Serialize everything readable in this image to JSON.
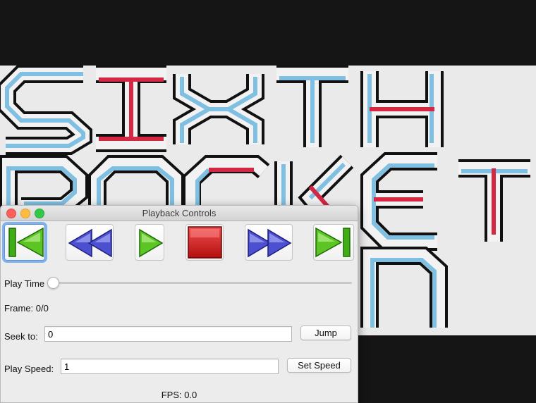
{
  "canvas": {
    "lines": [
      "SIXTH",
      "PACKET",
      "N"
    ],
    "colors": {
      "outline": "#111111",
      "fill": "#f2f2f2",
      "blue": "#7fbfe2",
      "red": "#d32743"
    }
  },
  "window": {
    "title": "Playback Controls",
    "buttons": [
      {
        "name": "jump-to-start",
        "icon": "skip-to-start-icon"
      },
      {
        "name": "rewind",
        "icon": "rewind-icon"
      },
      {
        "name": "play",
        "icon": "play-icon"
      },
      {
        "name": "stop",
        "icon": "stop-icon"
      },
      {
        "name": "fast-forward",
        "icon": "fast-forward-icon"
      },
      {
        "name": "jump-to-end",
        "icon": "skip-to-end-icon"
      }
    ],
    "play_time_label": "Play Time",
    "play_time_value": 0,
    "frame_text": "Frame: 0/0",
    "seek_label": "Seek to:",
    "seek_value": "0",
    "jump_label": "Jump",
    "speed_label": "Play Speed:",
    "speed_value": "1",
    "set_speed_label": "Set Speed",
    "fps_text": "FPS: 0.0"
  }
}
